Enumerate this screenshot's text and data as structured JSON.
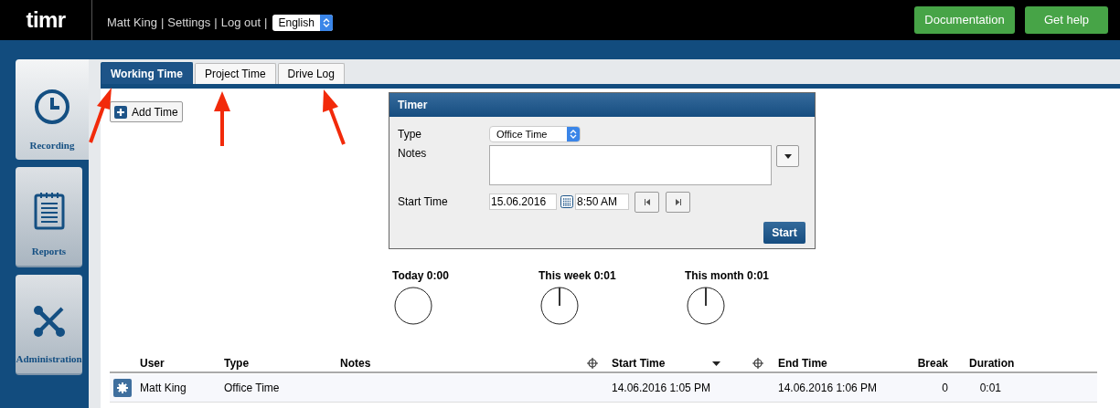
{
  "header": {
    "logo": "timr",
    "user_links": [
      {
        "label": "Matt King",
        "separator": "|"
      },
      {
        "label": "Settings",
        "separator": "|"
      },
      {
        "label": "Log out",
        "separator": "|"
      }
    ],
    "language": {
      "value": "English"
    },
    "buttons": [
      "Documentation",
      "Get help"
    ]
  },
  "sidebar": {
    "items": [
      {
        "label": "Recording",
        "kind": "clock",
        "selected": true
      },
      {
        "label": "Reports",
        "kind": "notepad",
        "selected": false
      },
      {
        "label": "Administration",
        "kind": "tools",
        "selected": false
      }
    ]
  },
  "tabs": [
    {
      "label": "Working Time",
      "selected": true
    },
    {
      "label": "Project Time",
      "selected": false
    },
    {
      "label": "Drive Log",
      "selected": false
    }
  ],
  "add_button": "Add Time",
  "timer": {
    "title": "Timer",
    "type_label": "Type",
    "type_value": "Office Time",
    "notes_label": "Notes",
    "start_label": "Start Time",
    "date": "15.06.2016",
    "time": "8:50 AM",
    "start_button": "Start"
  },
  "totals": [
    {
      "label": "Today 0:00",
      "hand": false
    },
    {
      "label": "This week 0:01",
      "hand": true
    },
    {
      "label": "This month 0:01",
      "hand": true
    }
  ],
  "table": {
    "columns": [
      "User",
      "Type",
      "Notes",
      "Start Time",
      "End Time",
      "Break",
      "Duration"
    ],
    "rows": [
      {
        "user": "Matt King",
        "type": "Office Time",
        "start": "14.06.2016 1:05 PM",
        "end": "14.06.2016 1:06 PM",
        "break": "0",
        "duration": "0:01"
      }
    ]
  }
}
